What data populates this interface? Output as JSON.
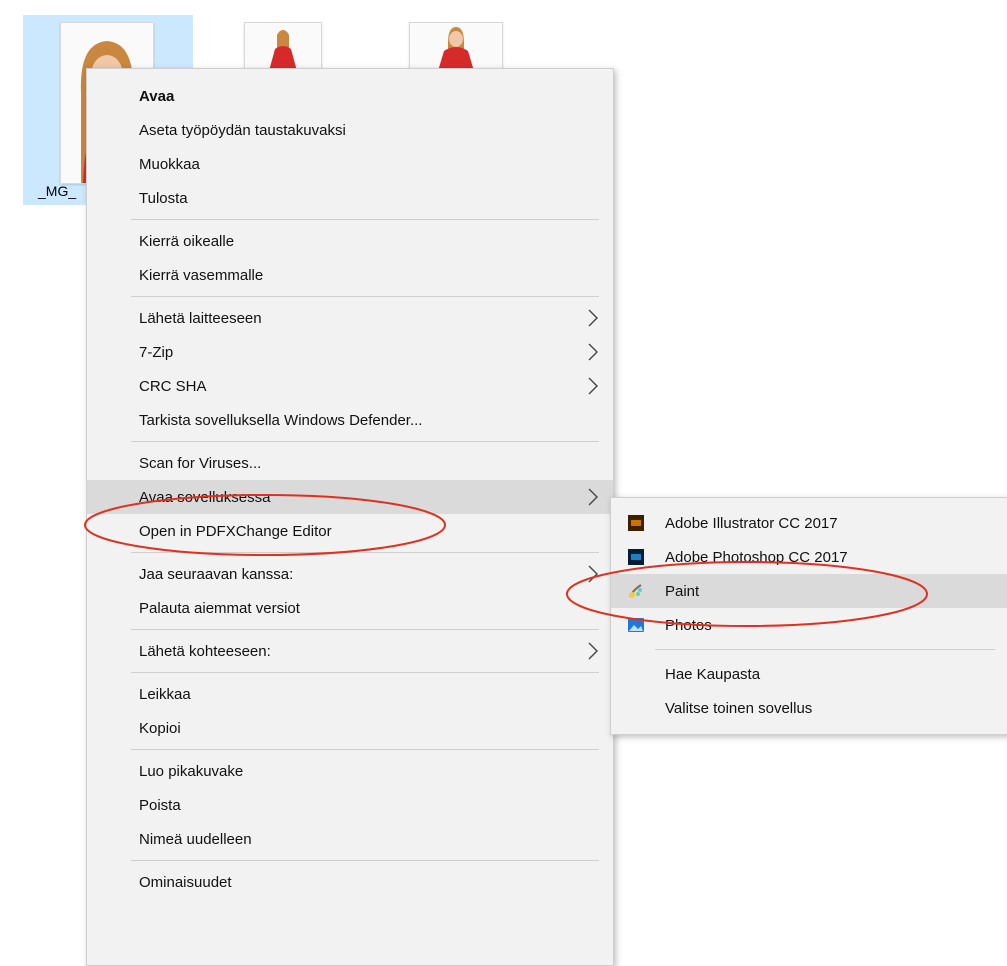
{
  "files": [
    {
      "name": "_MG_",
      "selected": true
    },
    {
      "name": "",
      "selected": false
    },
    {
      "name": "",
      "selected": false
    }
  ],
  "context_menu": {
    "groups": [
      [
        {
          "label": "Avaa",
          "bold": true
        },
        {
          "label": "Aseta työpöydän taustakuvaksi"
        },
        {
          "label": "Muokkaa"
        },
        {
          "label": "Tulosta"
        }
      ],
      [
        {
          "label": "Kierrä oikealle"
        },
        {
          "label": "Kierrä vasemmalle"
        }
      ],
      [
        {
          "label": "Lähetä laitteeseen",
          "submenu": true
        },
        {
          "label": "7-Zip",
          "submenu": true
        },
        {
          "label": "CRC SHA",
          "submenu": true
        },
        {
          "label": "Tarkista sovelluksella Windows Defender..."
        }
      ],
      [
        {
          "label": "Scan for Viruses..."
        },
        {
          "label": "Avaa sovelluksessa",
          "submenu": true,
          "hovered": true
        },
        {
          "label": "Open in PDFXChange Editor"
        }
      ],
      [
        {
          "label": "Jaa seuraavan kanssa:",
          "submenu": true
        },
        {
          "label": "Palauta aiemmat versiot"
        }
      ],
      [
        {
          "label": "Lähetä kohteeseen:",
          "submenu": true
        }
      ],
      [
        {
          "label": "Leikkaa"
        },
        {
          "label": "Kopioi"
        }
      ],
      [
        {
          "label": "Luo pikakuvake"
        },
        {
          "label": "Poista"
        },
        {
          "label": "Nimeä uudelleen"
        }
      ],
      [
        {
          "label": "Ominaisuudet"
        }
      ]
    ]
  },
  "open_with_submenu": {
    "apps": [
      {
        "label": "Adobe Illustrator CC 2017",
        "icon": "illustrator-icon",
        "color": "#3d1f00",
        "accent": "#ff9a00"
      },
      {
        "label": "Adobe Photoshop CC 2017",
        "icon": "photoshop-icon",
        "color": "#001e36",
        "accent": "#31a8ff"
      },
      {
        "label": "Paint",
        "icon": "paint-icon",
        "hovered": true
      },
      {
        "label": "Photos",
        "icon": "photos-icon",
        "color": "#1e78d6"
      }
    ],
    "extra": [
      {
        "label": "Hae Kaupasta"
      },
      {
        "label": "Valitse toinen sovellus"
      }
    ]
  },
  "annotation_color": "#e0301e"
}
